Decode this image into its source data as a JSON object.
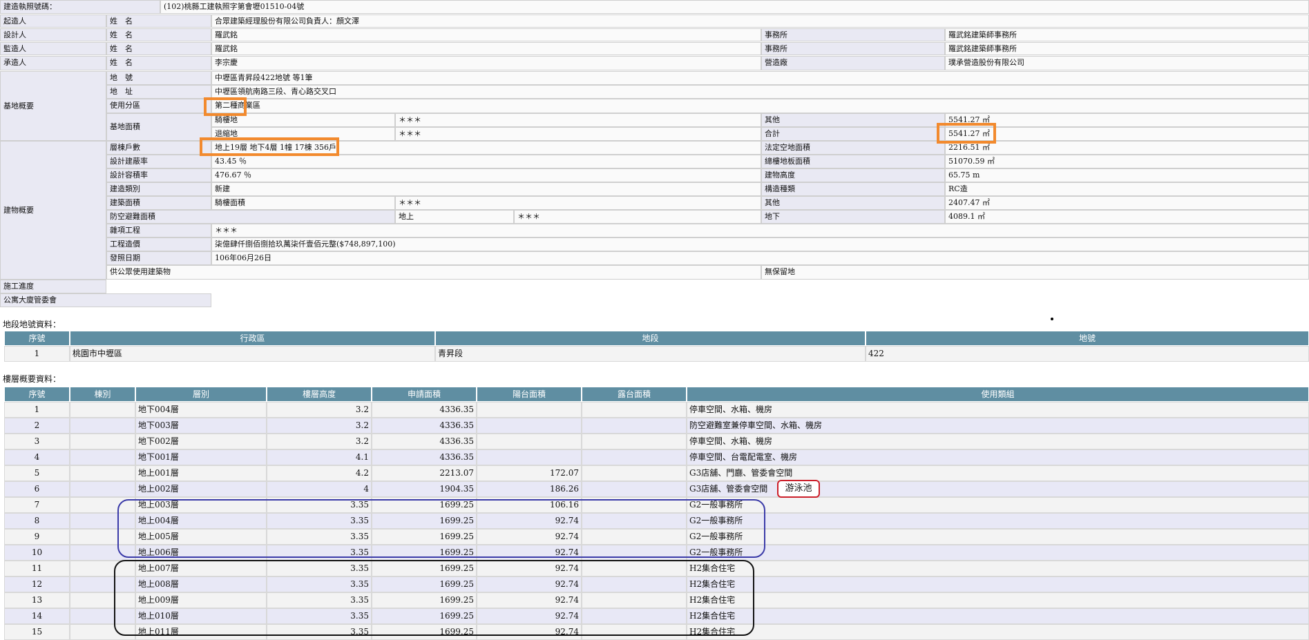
{
  "license": {
    "label": "建造執照號碼：",
    "value": "(102)桃縣工建執照字第會壢01510-04號"
  },
  "builder": {
    "role": "起造人",
    "name_label": "姓　名",
    "name": "合眾建築經理股份有限公司負責人：顏文澤"
  },
  "designer": {
    "role": "設計人",
    "name_label": "姓　名",
    "name": "羅武銘",
    "office_label": "事務所",
    "office": "羅武銘建築師事務所"
  },
  "supervisor": {
    "role": "監造人",
    "name_label": "姓　名",
    "name": "羅武銘",
    "office_label": "事務所",
    "office": "羅武銘建築師事務所"
  },
  "contractor": {
    "role": "承造人",
    "name_label": "姓　名",
    "name": "李宗慶",
    "company_label": "營造廠",
    "company": "璞承營造股份有限公司"
  },
  "site": {
    "section": "基地概要",
    "lot_label": "地　號",
    "lot": "中壢區青昇段422地號 等1筆",
    "address_label": "地　址",
    "address": "中壢區領航南路三段、青心路交叉口",
    "zoning_label": "使用分區",
    "zoning": "第二種商業區",
    "area_label": "基地面積",
    "arcade_label": "騎樓地",
    "arcade": "＊＊＊",
    "setback_label": "退縮地",
    "setback": "＊＊＊",
    "other_label": "其他",
    "other": "5541.27 ㎡",
    "total_label": "合計",
    "total": "5541.27 ㎡"
  },
  "building": {
    "section": "建物概要",
    "floors_label": "層棟戶數",
    "floors": "地上19層 地下4層 1幢 17棟 356戶",
    "open_space_label": "法定空地面積",
    "open_space": "2216.51 ㎡",
    "coverage_label": "設計建蔽率",
    "coverage": "43.45 ％",
    "total_floor_label": "總樓地板面積",
    "total_floor": "51070.59 ㎡",
    "far_label": "設計容積率",
    "far": "476.67 ％",
    "height_label": "建物高度",
    "height": "65.75 m",
    "type_label": "建造類別",
    "type": "新建",
    "structure_label": "構造種類",
    "structure": "RC造",
    "build_area_label": "建築面積",
    "arcade_area_label": "騎樓面積",
    "arcade_area": "＊＊＊",
    "other_label": "其他",
    "other": "2407.47 ㎡",
    "shelter_label": "防空避難面積",
    "above_label": "地上",
    "above": "＊＊＊",
    "below_label": "地下",
    "below": "4089.1 ㎡",
    "misc_label": "雜項工程",
    "misc": "＊＊＊",
    "cost_label": "工程造價",
    "cost": "柒億肆仟捌佰捌拾玖萬柒仟壹佰元整($748,897,100)",
    "issue_label": "發照日期",
    "issue": "106年06月26日",
    "public_label": "供公眾使用建築物",
    "barrier_label": "無保留地"
  },
  "progress_label": "施工進度",
  "committee_label": "公寓大廈管委會",
  "land": {
    "title": "地段地號資料：",
    "headers": [
      "序號",
      "行政區",
      "地段",
      "地號"
    ],
    "rows": [
      [
        "1",
        "桃園市中壢區",
        "青昇段",
        "422"
      ]
    ]
  },
  "floors": {
    "title": "樓層概要資料：",
    "headers": [
      "序號",
      "棟別",
      "層別",
      "樓層高度",
      "申請面積",
      "陽台面積",
      "露台面積",
      "使用類組"
    ],
    "rows": [
      [
        "1",
        "",
        "地下004層",
        "3.2",
        "4336.35",
        "",
        "",
        "停車空間、水箱、機房"
      ],
      [
        "2",
        "",
        "地下003層",
        "3.2",
        "4336.35",
        "",
        "",
        "防空避難室兼停車空間、水箱、機房"
      ],
      [
        "3",
        "",
        "地下002層",
        "3.2",
        "4336.35",
        "",
        "",
        "停車空間、水箱、機房"
      ],
      [
        "4",
        "",
        "地下001層",
        "4.1",
        "4336.35",
        "",
        "",
        "停車空間、台電配電室、機房"
      ],
      [
        "5",
        "",
        "地上001層",
        "4.2",
        "2213.07",
        "172.07",
        "",
        "G3店舖、門廳、管委會空間"
      ],
      [
        "6",
        "",
        "地上002層",
        "4",
        "1904.35",
        "186.26",
        "",
        "G3店舖、管委會空間"
      ],
      [
        "7",
        "",
        "地上003層",
        "3.35",
        "1699.25",
        "106.16",
        "",
        "G2一般事務所"
      ],
      [
        "8",
        "",
        "地上004層",
        "3.35",
        "1699.25",
        "92.74",
        "",
        "G2一般事務所"
      ],
      [
        "9",
        "",
        "地上005層",
        "3.35",
        "1699.25",
        "92.74",
        "",
        "G2一般事務所"
      ],
      [
        "10",
        "",
        "地上006層",
        "3.35",
        "1699.25",
        "92.74",
        "",
        "G2一般事務所"
      ],
      [
        "11",
        "",
        "地上007層",
        "3.35",
        "1699.25",
        "92.74",
        "",
        "H2集合住宅"
      ],
      [
        "12",
        "",
        "地上008層",
        "3.35",
        "1699.25",
        "92.74",
        "",
        "H2集合住宅"
      ],
      [
        "13",
        "",
        "地上009層",
        "3.35",
        "1699.25",
        "92.74",
        "",
        "H2集合住宅"
      ],
      [
        "14",
        "",
        "地上010層",
        "3.35",
        "1699.25",
        "92.74",
        "",
        "H2集合住宅"
      ],
      [
        "15",
        "",
        "地上011層",
        "3.35",
        "1699.25",
        "92.74",
        "",
        "H2集合住宅"
      ]
    ]
  },
  "annotation": {
    "pool": "游泳池"
  },
  "colors": {
    "header": "#5f8ea2",
    "orange": "#f28a2e",
    "blue": "#3a3aa8",
    "red": "#cc1f2a",
    "black": "#111111"
  }
}
